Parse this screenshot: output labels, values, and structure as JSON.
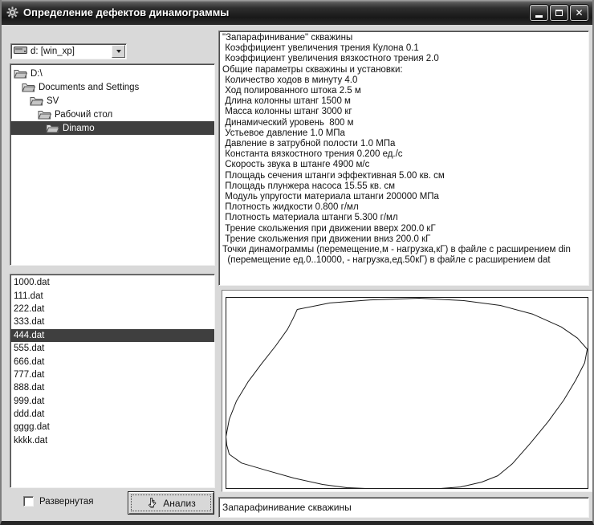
{
  "window": {
    "title": "Определение дефектов динамограммы"
  },
  "icons": {
    "app": "gear",
    "minimize": "underscore",
    "maximize": "square",
    "close_glyph": "✕",
    "dropdown": "▼",
    "drive": "disk-drive",
    "folder": "open-folder",
    "hand": "pointing-hand"
  },
  "drive_combo": {
    "value": "d: [win_xp]"
  },
  "directory_tree": {
    "items": [
      {
        "label": "D:\\",
        "level": 0,
        "selected": false
      },
      {
        "label": "Documents and Settings",
        "level": 1,
        "selected": false
      },
      {
        "label": "SV",
        "level": 2,
        "selected": false
      },
      {
        "label": "Рабочий стол",
        "level": 3,
        "selected": false
      },
      {
        "label": "Dinamo",
        "level": 4,
        "selected": true
      }
    ]
  },
  "file_list": {
    "items": [
      "1000.dat",
      "111.dat",
      "222.dat",
      "333.dat",
      "444.dat",
      "555.dat",
      "666.dat",
      "777.dat",
      "888.dat",
      "999.dat",
      "ddd.dat",
      "gggg.dat",
      "kkkk.dat"
    ],
    "selected_index": 4
  },
  "parameters_memo": {
    "lines": [
      "\"Запарафинивание\" скважины",
      " Коэффициент увеличения трения Кулона 0.1",
      " Коэффициент увеличения вязкостного трения 2.0",
      "Общие параметры скважины и установки:",
      " Количество ходов в минуту 4.0",
      " Ход полированного штока 2.5 м",
      " Длина колонны штанг 1500 м",
      " Масса колонны штанг 3000 кг",
      " Динамический уровень  800 м",
      " Устьевое давление 1.0 МПа",
      " Давление в затрубной полости 1.0 МПа",
      " Константа вязкостного трения 0.200 ед./с",
      " Скорость звука в штанге 4900 м/с",
      " Площадь сечения штанги эффективная 5.00 кв. см",
      " Площадь плунжера насоса 15.55 кв. см",
      " Модуль упругости материала штанги 200000 МПа",
      " Плотность жидкости 0.800 г/мл",
      " Плотность материала штанги 5.300 г/мл",
      " Трение скольжения при движении вверх 200.0 кГ",
      " Трение скольжения при движении вниз 200.0 кГ",
      "Точки динамограммы (перемещение,м - нагрузка,кГ) в файле с расширением din",
      "  (перемещение ед.0..10000, - нагрузка,ед.50кГ) в файле с расширением dat"
    ]
  },
  "chart_data": {
    "type": "line",
    "closed_loop": true,
    "xlabel": "",
    "ylabel": "",
    "note": "dynamogram loop (перемещение — нагрузка), axes and ticks not shown",
    "points_pct": [
      [
        19.7,
        6.3
      ],
      [
        28.7,
        2.9
      ],
      [
        39.9,
        1.3
      ],
      [
        53.4,
        0.4
      ],
      [
        65.7,
        1.7
      ],
      [
        75.8,
        4.2
      ],
      [
        84.8,
        8.8
      ],
      [
        92.6,
        15.4
      ],
      [
        97.1,
        21.3
      ],
      [
        99.8,
        27.1
      ],
      [
        99.1,
        34.2
      ],
      [
        96.6,
        43.3
      ],
      [
        93.3,
        53.8
      ],
      [
        89.0,
        65.0
      ],
      [
        84.1,
        76.3
      ],
      [
        79.1,
        87.1
      ],
      [
        75.1,
        93.3
      ],
      [
        70.6,
        96.7
      ],
      [
        64.8,
        99.2
      ],
      [
        59.2,
        100
      ],
      [
        48.9,
        100
      ],
      [
        38.8,
        100
      ],
      [
        33.4,
        99.6
      ],
      [
        26.7,
        97.9
      ],
      [
        18.8,
        94.6
      ],
      [
        11.0,
        90.4
      ],
      [
        4.3,
        86.7
      ],
      [
        0.9,
        82.1
      ],
      [
        0.2,
        77.1
      ],
      [
        0.0,
        72.9
      ],
      [
        0.9,
        63.8
      ],
      [
        2.9,
        54.2
      ],
      [
        6.1,
        44.2
      ],
      [
        9.9,
        34.6
      ],
      [
        13.7,
        25.4
      ],
      [
        17.0,
        16.7
      ],
      [
        18.6,
        10.8
      ]
    ]
  },
  "footer": {
    "checkbox_label": "Развернутая",
    "checkbox_checked": false,
    "analyze_button_label": "Анализ",
    "result_text": "Запарафинивание скважины"
  },
  "colors": {
    "titlebar_dark": "#1e1e1e",
    "selection": "#3f3f3f",
    "window_bg": "#d9d9d9",
    "panel_bg": "#ffffff",
    "curve": "#1a1a1a"
  }
}
